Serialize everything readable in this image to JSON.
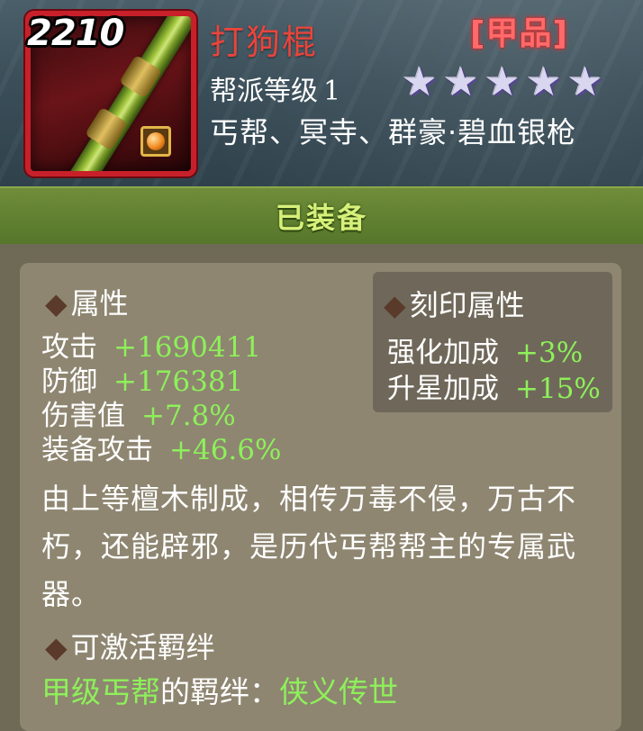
{
  "item": {
    "level": "2210",
    "name": "打狗棍",
    "grade": "[甲品]",
    "guild_level_label": "帮派等级",
    "guild_level_value": "1",
    "stars": 5,
    "sects": "丐帮、冥寺、群豪·碧血银枪",
    "colors": {
      "name": "#e8453c",
      "grade": "#ff6a6a",
      "frame": "#c8202a"
    }
  },
  "equipped_label": "已装备",
  "attributes": {
    "title": "属性",
    "rows": [
      {
        "label": "攻击",
        "value": "+1690411"
      },
      {
        "label": "防御",
        "value": "+176381"
      },
      {
        "label": "伤害值",
        "value": "+7.8%"
      },
      {
        "label": "装备攻击",
        "value": "+46.6%"
      }
    ]
  },
  "imprint": {
    "title": "刻印属性",
    "rows": [
      {
        "label": "强化加成",
        "value": "+3%"
      },
      {
        "label": "升星加成",
        "value": "+15%"
      }
    ]
  },
  "description": "由上等檀木制成，相传万毒不侵，万古不朽，还能辟邪，是历代丐帮帮主的专属武器。",
  "bond": {
    "title": "可激活羁绊",
    "source": "甲级丐帮",
    "middle": "的羁绊：",
    "name": "侠义传世"
  },
  "icons": [
    "weapon-icon",
    "gem-slot-icon",
    "star-icon",
    "diamond-bullet-icon"
  ]
}
